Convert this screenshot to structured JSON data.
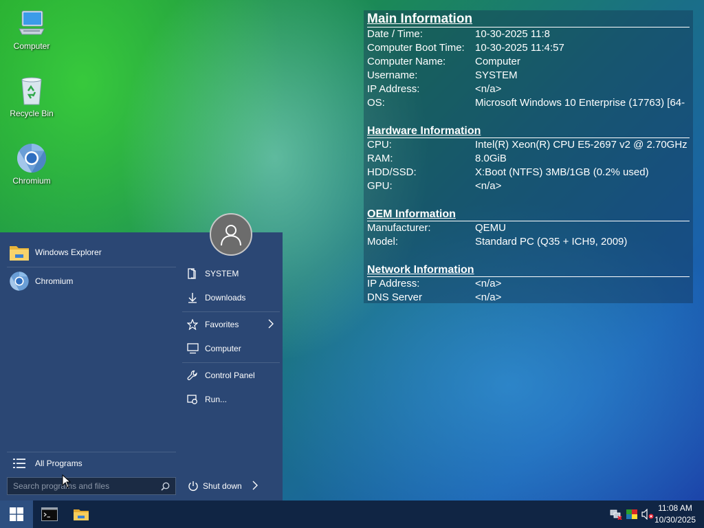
{
  "desktop": {
    "icons": [
      {
        "label": "Computer",
        "icon": "computer-icon"
      },
      {
        "label": "Recycle Bin",
        "icon": "recycle-bin-icon"
      },
      {
        "label": "Chromium",
        "icon": "chromium-icon"
      }
    ]
  },
  "info_panel": {
    "main": {
      "title": "Main Information",
      "rows": [
        {
          "k": "Date / Time:",
          "v": "10-30-2025 11:8"
        },
        {
          "k": "Computer Boot Time:",
          "v": "10-30-2025 11:4:57"
        },
        {
          "k": "Computer Name:",
          "v": "Computer"
        },
        {
          "k": "Username:",
          "v": "SYSTEM"
        },
        {
          "k": "IP Address:",
          "v": "<n/a>"
        },
        {
          "k": "OS:",
          "v": "Microsoft Windows 10 Enterprise (17763) [64-"
        }
      ]
    },
    "hardware": {
      "title": "Hardware Information",
      "rows": [
        {
          "k": "CPU:",
          "v": "Intel(R) Xeon(R) CPU E5-2697 v2 @ 2.70GHz"
        },
        {
          "k": "RAM:",
          "v": "8.0GiB"
        },
        {
          "k": "HDD/SSD:",
          "v": "X:Boot (NTFS) 3MB/1GB (0.2% used)"
        },
        {
          "k": "GPU:",
          "v": "<n/a>"
        }
      ]
    },
    "oem": {
      "title": "OEM Information",
      "rows": [
        {
          "k": "Manufacturer:",
          "v": "QEMU"
        },
        {
          "k": "Model:",
          "v": "Standard PC (Q35 + ICH9, 2009)"
        }
      ]
    },
    "network": {
      "title": "Network Information",
      "rows": [
        {
          "k": "IP Address:",
          "v": "<n/a>"
        },
        {
          "k": "DNS Server",
          "v": "<n/a>"
        }
      ]
    }
  },
  "start_menu": {
    "programs": [
      {
        "label": "Windows Explorer",
        "icon": "folder-icon"
      },
      {
        "label": "Chromium",
        "icon": "chromium-icon"
      }
    ],
    "all_programs": "All Programs",
    "search_placeholder": "Search programs and files",
    "right_items": [
      {
        "label": "SYSTEM",
        "icon": "user-folder-icon"
      },
      {
        "label": "Downloads",
        "icon": "download-icon"
      },
      {
        "label": "Favorites",
        "icon": "star-icon"
      },
      {
        "label": "Computer",
        "icon": "computer-icon"
      },
      {
        "label": "Control Panel",
        "icon": "wrench-icon"
      },
      {
        "label": "Run...",
        "icon": "run-icon"
      }
    ],
    "shutdown": "Shut down"
  },
  "taskbar": {
    "apps": [
      {
        "icon": "command-prompt-icon"
      },
      {
        "icon": "file-explorer-icon"
      }
    ],
    "tray": [
      {
        "icon": "network-icon"
      },
      {
        "icon": "display-icon"
      },
      {
        "icon": "volume-muted-icon"
      }
    ],
    "time": "11:08 AM",
    "date": "10/30/2025"
  },
  "colors": {
    "start_menu_bg": "#2b4774",
    "taskbar_bg": "#102544",
    "start_button_bg": "#2d4f80"
  }
}
